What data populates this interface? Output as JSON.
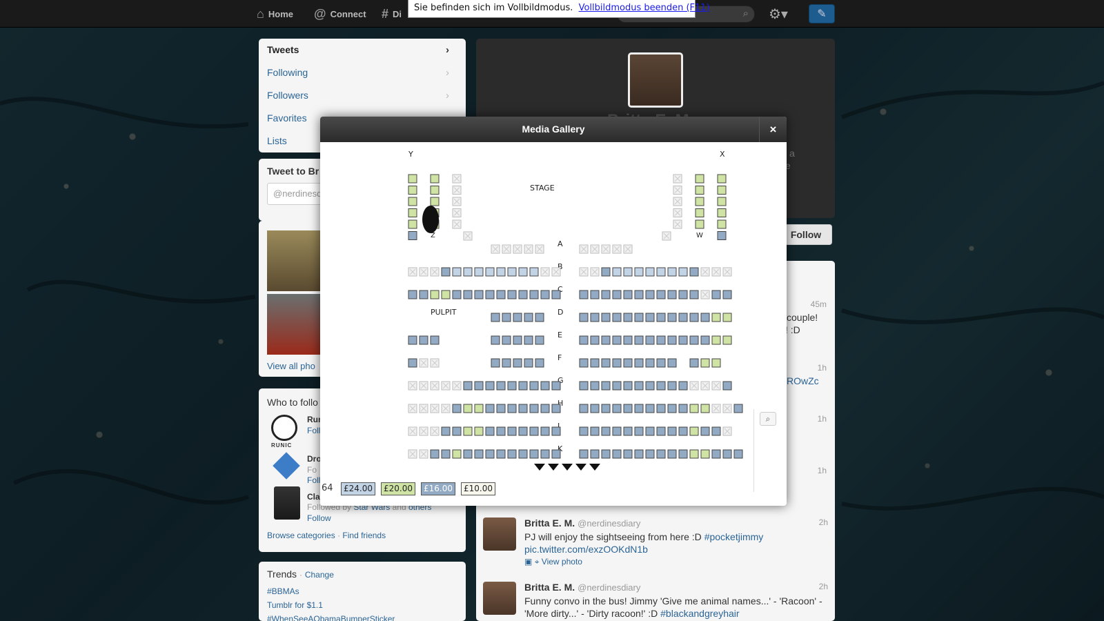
{
  "nav": {
    "home": "Home",
    "connect": "Connect",
    "discover_partial": "Di"
  },
  "fullscreen_notice": {
    "text": "Sie befinden sich im Vollbildmodus.",
    "exit_link": "Vollbildmodus beenden (F11)"
  },
  "sidebar": {
    "items": [
      {
        "label": "Tweets"
      },
      {
        "label": "Following"
      },
      {
        "label": "Followers"
      },
      {
        "label": "Favorites"
      },
      {
        "label": "Lists"
      }
    ],
    "tweet_to_label": "Tweet to Br",
    "tweet_to_placeholder": "@nerdinesd",
    "view_all_photos": "View all pho",
    "who_to_follow": "Who to follo",
    "suggestions": [
      {
        "name": "Run",
        "action": "Follo",
        "logo_text": "RUNIC"
      },
      {
        "name": "Dro",
        "sub": "Fo",
        "action": "Follo"
      },
      {
        "name": "Cla",
        "sub_prefix": "Followed by",
        "sub_link1": "Star Wars",
        "sub_and": "and",
        "sub_link2": "others",
        "action": "Follow"
      }
    ],
    "browse_categories": "Browse categories",
    "find_friends": "Find friends",
    "trends_title": "Trends",
    "trends_change": "Change",
    "trends": [
      "#BBMAs",
      "Tumblr for $1.1",
      "#WhenSeeAObamaBumperSticker"
    ]
  },
  "profile": {
    "name_partial": "Britta E. M.",
    "bio_partial_1": "ly a",
    "bio_partial_2": "e",
    "follow_button": "Follow"
  },
  "tweets_partial": [
    {
      "time": "45m",
      "text_1": "couple!",
      "text_2": "! :D"
    },
    {
      "time": "1h",
      "text": "ROwZc"
    },
    {
      "time": "1h"
    },
    {
      "time": "1h"
    }
  ],
  "tweets": [
    {
      "name": "Britta E. M.",
      "handle": "@nerdinesdiary",
      "time": "2h",
      "text": "PJ will enjoy the sightseeing from here :D",
      "hashtag": "#pocketjimmy",
      "link": "pic.twitter.com/exzOOKdN1b",
      "meta": "View photo"
    },
    {
      "name": "Britta E. M.",
      "handle": "@nerdinesdiary",
      "time": "2h",
      "text": "Funny convo in the bus! Jimmy 'Give me animal names...' - 'Racoon' - 'More dirty...' - 'Dirty racoon!' :D",
      "hashtag": "#blackandgreyhair"
    }
  ],
  "modal": {
    "title": "Media Gallery",
    "close": "×",
    "zoom_icon": "magnifier-icon"
  },
  "seatmap": {
    "stage_label": "STAGE",
    "pulpit_label": "PULPIT",
    "corner_labels": {
      "left": "Y",
      "right": "X",
      "left_bottom": "Z",
      "right_bottom": "W"
    },
    "rows": [
      "A",
      "B",
      "C",
      "D",
      "E",
      "F",
      "G",
      "H",
      "J",
      "K"
    ],
    "legend_count": "64",
    "prices": [
      "£24.00",
      "£20.00",
      "£16.00",
      "£10.00"
    ],
    "colors": {
      "price_24": "#c3d3e6",
      "price_20": "#cfe3a4",
      "price_16": "#93aac4",
      "price_10": "#f6f6ec",
      "unavailable": "#f1f1f1"
    }
  }
}
